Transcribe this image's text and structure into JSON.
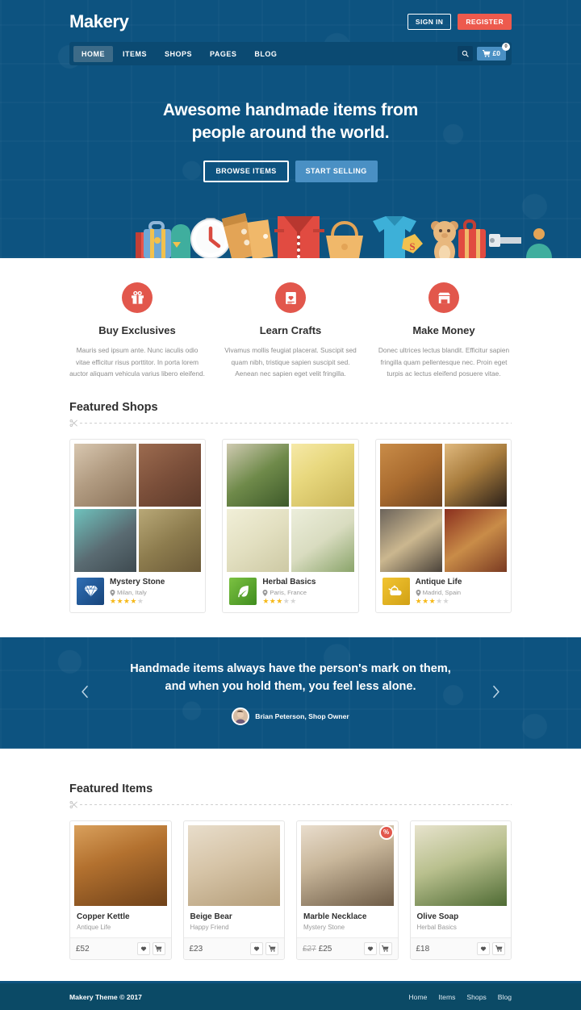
{
  "brand": {
    "logo": "Makery"
  },
  "topbar": {
    "sign_in": "SIGN IN",
    "register": "REGISTER"
  },
  "nav": {
    "items": [
      {
        "label": "HOME",
        "active": true
      },
      {
        "label": "ITEMS",
        "active": false
      },
      {
        "label": "SHOPS",
        "active": false
      },
      {
        "label": "PAGES",
        "active": false
      },
      {
        "label": "BLOG",
        "active": false
      }
    ],
    "cart_total": "£0",
    "cart_count": "0"
  },
  "hero": {
    "title_line1": "Awesome handmade items from",
    "title_line2": "people around the world.",
    "btn_browse": "BROWSE ITEMS",
    "btn_selling": "START SELLING"
  },
  "features": [
    {
      "icon": "gift-icon",
      "title": "Buy Exclusives",
      "text": "Mauris sed ipsum ante. Nunc iaculis odio vitae efficitur risus porttitor. In porta lorem auctor aliquam vehicula varius libero eleifend."
    },
    {
      "icon": "book-heart-icon",
      "title": "Learn Crafts",
      "text": "Vivamus mollis feugiat placerat. Suscipit sed quam nibh, tristique sapien suscipit sed. Aenean nec sapien eget velit fringilla."
    },
    {
      "icon": "storefront-icon",
      "title": "Make Money",
      "text": "Donec ultrices lectus blandit. Efficitur sapien fringilla quam pellentesque nec. Proin eget turpis ac lectus eleifend posuere vitae."
    }
  ],
  "featured_shops": {
    "title": "Featured Shops",
    "shops": [
      {
        "name": "Mystery Stone",
        "location": "Milan, Italy",
        "rating": 4,
        "rating_max": 5,
        "logo_icon": "diamond-icon"
      },
      {
        "name": "Herbal Basics",
        "location": "Paris, France",
        "rating": 3,
        "rating_max": 5,
        "logo_icon": "leaf-icon"
      },
      {
        "name": "Antique Life",
        "location": "Madrid, Spain",
        "rating": 3,
        "rating_max": 5,
        "logo_icon": "teapot-icon"
      }
    ]
  },
  "testimonial": {
    "quote_line1": "Handmade items always have the person's mark on them,",
    "quote_line2": "and when you hold them, you feel less alone.",
    "author": "Brian Peterson, Shop Owner",
    "prev_icon": "chevron-left-icon",
    "next_icon": "chevron-right-icon"
  },
  "featured_items": {
    "title": "Featured Items",
    "items": [
      {
        "name": "Copper Kettle",
        "shop": "Antique Life",
        "price": "£52",
        "old_price": "",
        "on_sale": false,
        "sale_badge": "%"
      },
      {
        "name": "Beige Bear",
        "shop": "Happy Friend",
        "price": "£23",
        "old_price": "",
        "on_sale": false,
        "sale_badge": "%"
      },
      {
        "name": "Marble Necklace",
        "shop": "Mystery Stone",
        "price": "£25",
        "old_price": "£27",
        "on_sale": true,
        "sale_badge": "%"
      },
      {
        "name": "Olive Soap",
        "shop": "Herbal Basics",
        "price": "£18",
        "old_price": "",
        "on_sale": false,
        "sale_badge": "%"
      }
    ]
  },
  "footer": {
    "copyright": "Makery Theme © 2017",
    "links": [
      "Home",
      "Items",
      "Shops",
      "Blog"
    ]
  },
  "colors": {
    "hero_blue": "#0d5380",
    "nav_blue": "#0b4a72",
    "accent_red": "#ed5a4d",
    "icon_red": "#e2574c",
    "button_blue": "#4a90c4",
    "star_gold": "#f6b91a",
    "footer_blue": "#0b4a66"
  }
}
